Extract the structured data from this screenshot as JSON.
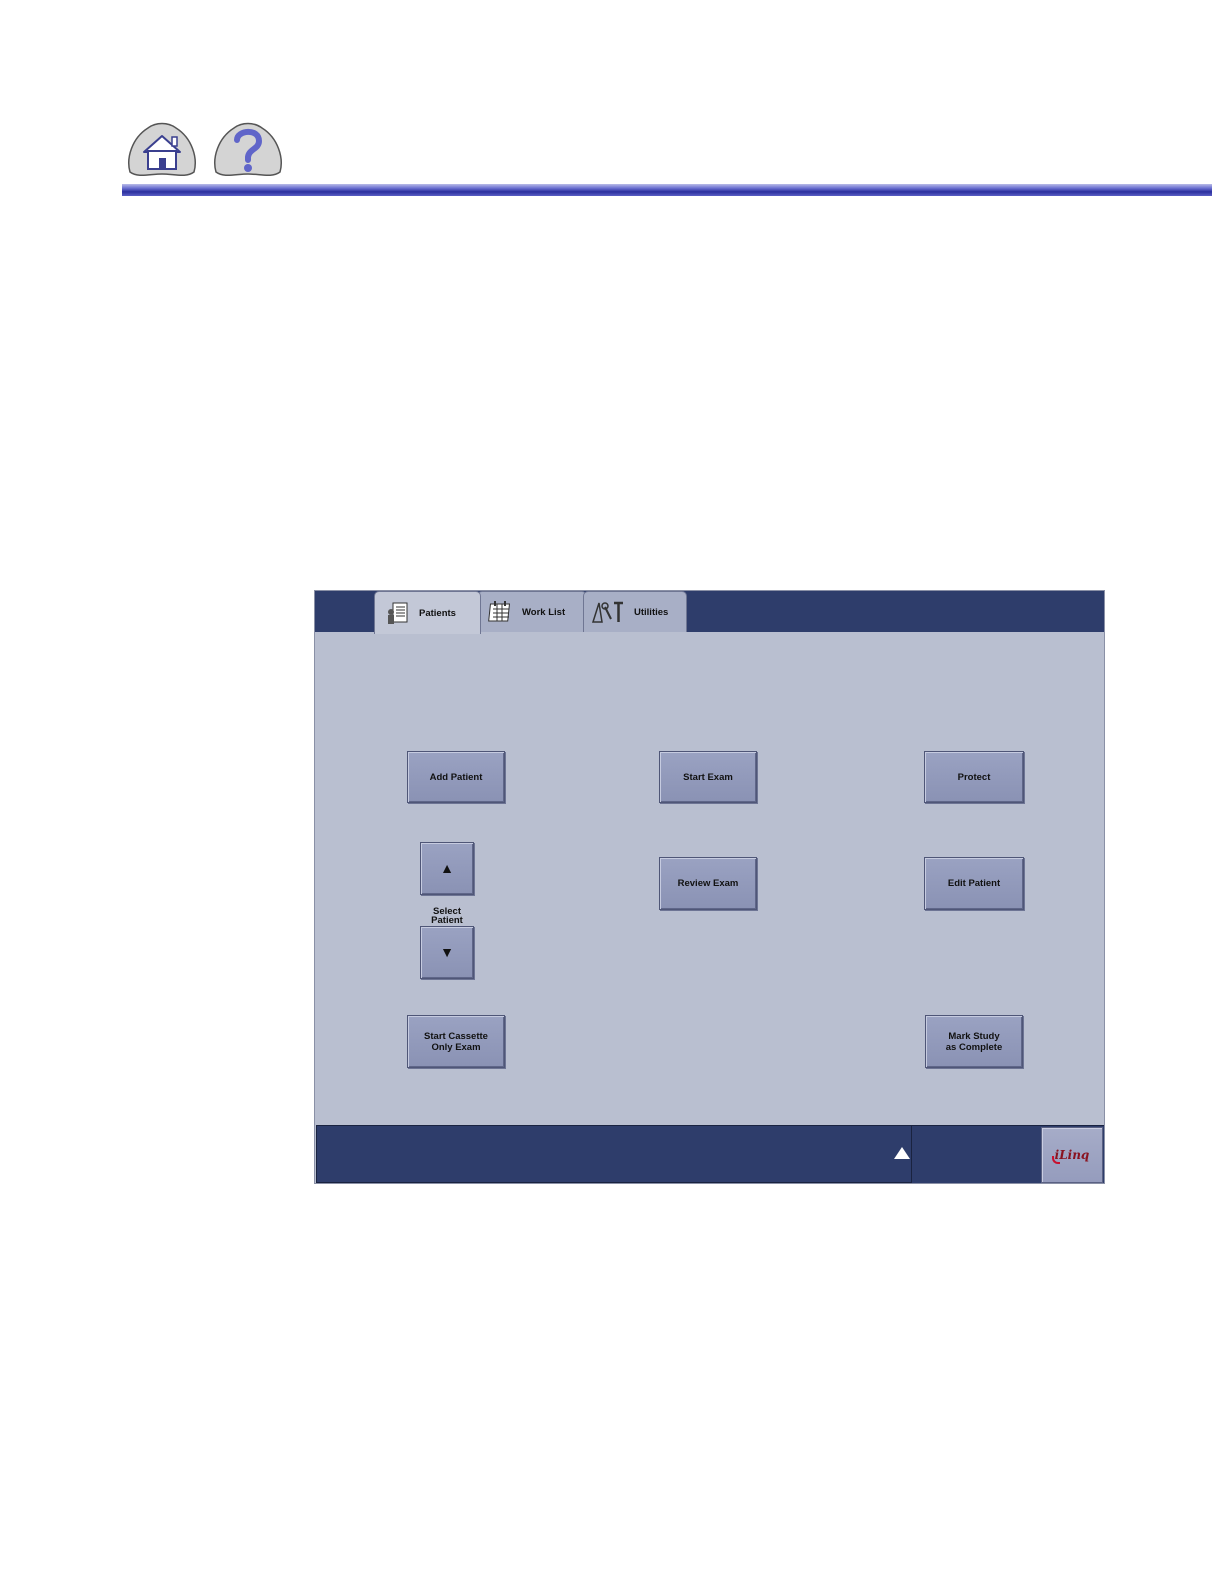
{
  "header": {
    "home_icon": "home-icon",
    "help_icon": "help-icon"
  },
  "tabs": [
    {
      "label": "Patients",
      "icon": "patient-list-icon",
      "active": true
    },
    {
      "label": "Work List",
      "icon": "calendar-icon",
      "active": false
    },
    {
      "label": "Utilities",
      "icon": "tools-icon",
      "active": false
    }
  ],
  "buttons": {
    "add_patient": "Add Patient",
    "start_exam": "Start Exam",
    "protect": "Protect",
    "review_exam": "Review Exam",
    "edit_patient": "Edit Patient",
    "start_cassette_line1": "Start Cassette",
    "start_cassette_line2": "Only Exam",
    "mark_study_line1": "Mark Study",
    "mark_study_line2": "as Complete",
    "select_up": "▲",
    "select_down": "▼",
    "select_label_line1": "Select",
    "select_label_line2": "Patient"
  },
  "bottom": {
    "logo": "iLinq"
  },
  "colors": {
    "panel": "#b9bfd0",
    "bar": "#2e3d6b",
    "button": "#9aa2c2",
    "rule": "#2b2f9e"
  }
}
